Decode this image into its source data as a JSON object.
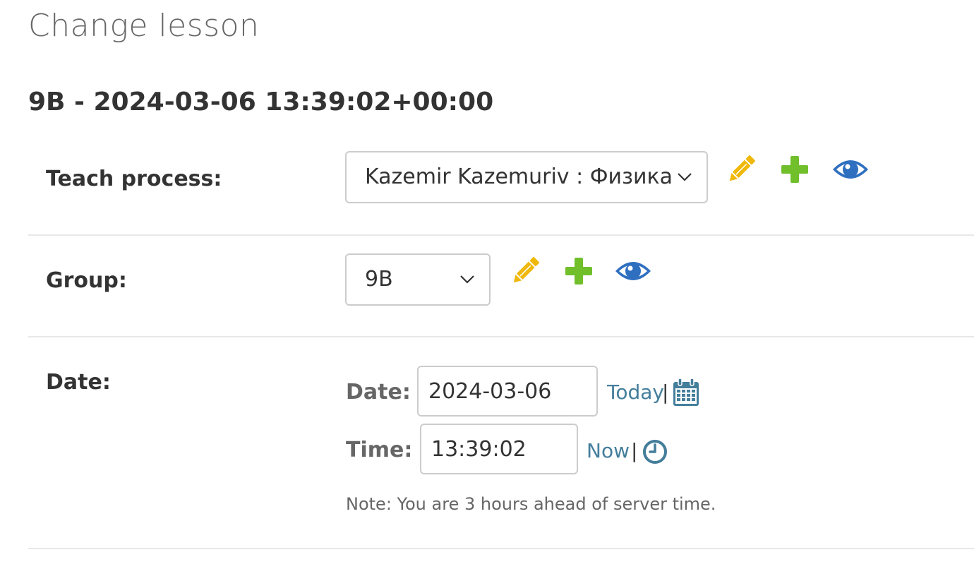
{
  "page": {
    "title": "Change lesson",
    "object_title": "9B - 2024-03-06 13:39:02+00:00"
  },
  "fields": {
    "teach_process": {
      "label": "Teach process:",
      "selected": "Kazemir Kazemuriv : Физика"
    },
    "group": {
      "label": "Group:",
      "selected": "9B"
    },
    "date": {
      "label": "Date:",
      "date_label": "Date:",
      "date_value": "2024-03-06",
      "today_link": "Today",
      "separator": "|",
      "time_label": "Time:",
      "time_value": "13:39:02",
      "now_link": "Now",
      "note": "Note: You are 3 hours ahead of server time."
    }
  },
  "icons": {
    "edit": "pencil-icon",
    "add": "plus-icon",
    "view": "eye-icon",
    "calendar": "calendar-icon",
    "clock": "clock-icon"
  },
  "colors": {
    "edit": "#efb80b",
    "add": "#70bf2b",
    "view": "#2f6fc0",
    "link": "#447e9b"
  }
}
